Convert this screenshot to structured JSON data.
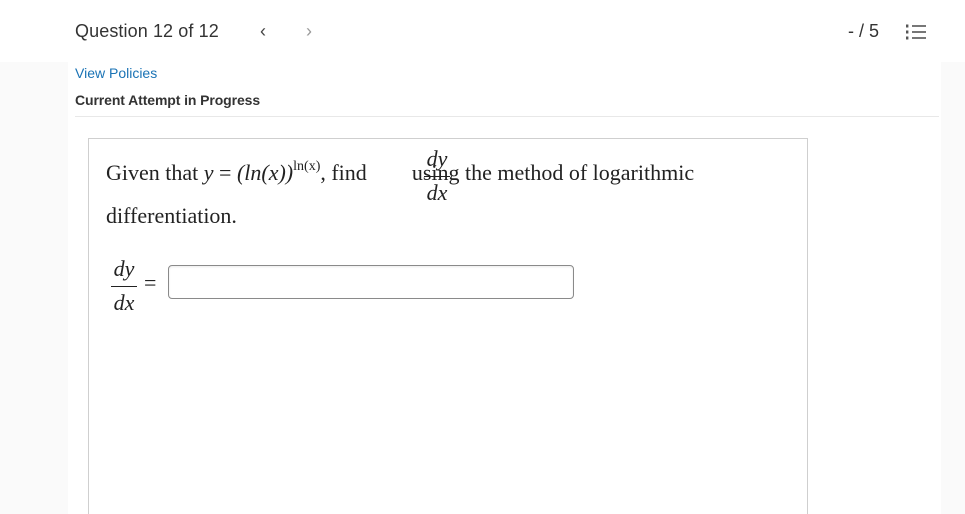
{
  "header": {
    "question_counter": "Question 12 of 12",
    "prev_label": "‹",
    "next_label": "›",
    "score": "- / 5"
  },
  "links": {
    "view_policies": "View Policies"
  },
  "status": {
    "attempt": "Current Attempt in Progress"
  },
  "question": {
    "given_that": "Given that ",
    "y_var": "y",
    "equals": " = ",
    "base": "(ln(x))",
    "exponent": "ln(x)",
    "find": ", find ",
    "frac_num": "dy",
    "frac_den": "dx",
    "rest": " using the method of logarithmic",
    "line2": "differentiation."
  },
  "answer": {
    "frac_num": "dy",
    "frac_den": "dx",
    "equals": "=",
    "value": "",
    "placeholder": ""
  },
  "icons": {
    "prev": "chevron-left-icon",
    "next": "chevron-right-icon",
    "list": "list-icon"
  },
  "colors": {
    "link": "#1a73b5",
    "text": "#333333"
  }
}
